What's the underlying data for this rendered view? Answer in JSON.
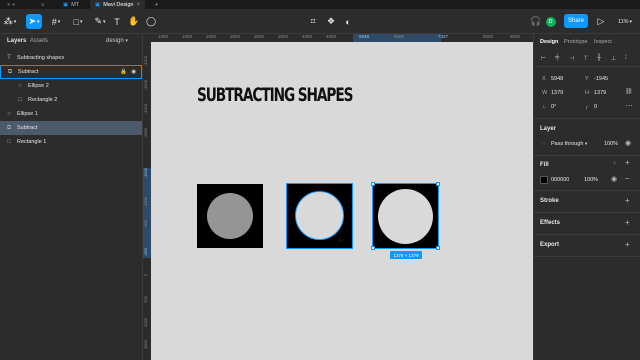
{
  "tabs": {
    "mt": "MT",
    "active": "Mavi Design"
  },
  "toolbar": {
    "share_label": "Share",
    "zoom": "11%",
    "avatar_initial": "D"
  },
  "left_panel": {
    "tab_layers": "Layers",
    "tab_assets": "Assets",
    "page": "design",
    "layers": [
      {
        "label": "Subtracting shapes"
      },
      {
        "label": "Subtract"
      },
      {
        "label": "Ellipse 2"
      },
      {
        "label": "Rectangle 2"
      },
      {
        "label": "Ellipse 1"
      },
      {
        "label": "Subtract"
      },
      {
        "label": "Rectangle 1"
      }
    ]
  },
  "canvas": {
    "title": "SUBTRACTING SHAPES",
    "size_badge": "1379 × 1379",
    "ruler_top": [
      "1000",
      "1500",
      "2000",
      "2500",
      "3000",
      "3500",
      "4000",
      "4500",
      "5948",
      "6500",
      "7327",
      "8500",
      "9000"
    ],
    "ruler_left": [
      "-4000",
      "-3500",
      "-3000",
      "-2500",
      "-1945",
      "-1000",
      "-500",
      "-566",
      "0",
      "500",
      "1000",
      "1500"
    ]
  },
  "right_panel": {
    "tab_design": "Design",
    "tab_prototype": "Prototype",
    "tab_inspect": "Inspect",
    "x_label": "X",
    "x_value": "5948",
    "y_label": "Y",
    "y_value": "-1945",
    "w_label": "W",
    "w_value": "1379",
    "h_label": "H",
    "h_value": "1379",
    "rotation": "0°",
    "radius": "0",
    "layer_heading": "Layer",
    "blend_mode": "Pass through",
    "layer_opacity": "100%",
    "fill_heading": "Fill",
    "fill_hex": "000000",
    "fill_opacity": "100%",
    "stroke_heading": "Stroke",
    "effects_heading": "Effects",
    "export_heading": "Export",
    "fill_color": "#000000",
    "accent": "#0d99ff"
  }
}
